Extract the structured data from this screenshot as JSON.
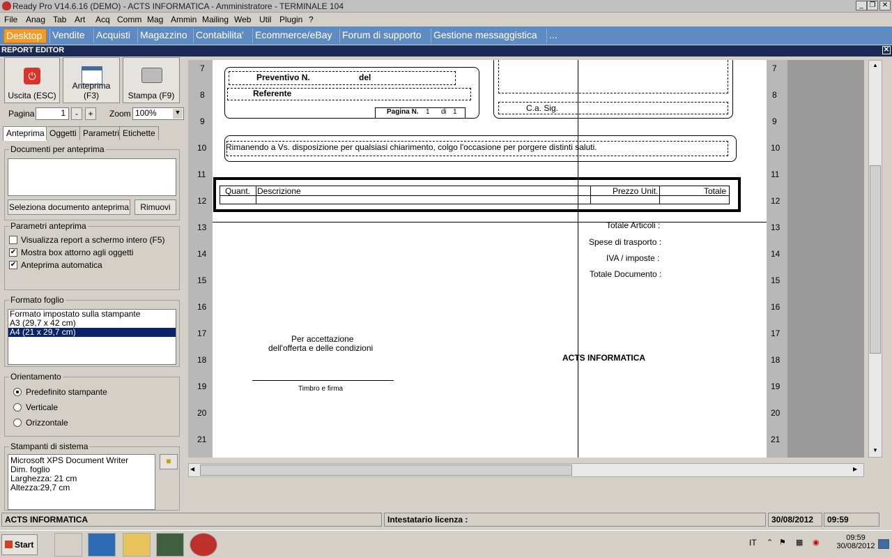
{
  "window": {
    "title": "Ready Pro V14.6.16 (DEMO)  - ACTS INFORMATICA - Amministratore - TERMINALE 104",
    "min": "_",
    "max": "❐",
    "close": "✕"
  },
  "menu": [
    "File",
    "Anag",
    "Tab",
    "Art",
    "Acq",
    "Comm",
    "Mag",
    "Ammin",
    "Mailing",
    "Web",
    "Util",
    "Plugin",
    "?"
  ],
  "main_tabs": [
    "Desktop",
    "Vendite",
    "Acquisti",
    "Magazzino",
    "Contabilita'",
    "Ecommerce/eBay",
    "Forum di supporto",
    "Gestione messaggistica",
    "..."
  ],
  "report_editor": {
    "title": "REPORT EDITOR",
    "close": "✕"
  },
  "toolbar": {
    "exit": "Uscita (ESC)",
    "preview": "Anteprima (F3)",
    "print": "Stampa (F9)"
  },
  "pager": {
    "label": "Pagina",
    "value": "1",
    "minus": "-",
    "plus": "+",
    "zoom_label": "Zoom",
    "zoom_value": "100%"
  },
  "subtabs": [
    "Anteprima",
    "Oggetti",
    "Parametri",
    "Etichette"
  ],
  "docs": {
    "title": "Documenti per anteprima",
    "select_btn": "Seleziona documento anteprima",
    "remove_btn": "Rimuovi"
  },
  "params": {
    "title": "Parametri anteprima",
    "opt1": "Visualizza report a schermo intero (F5)",
    "opt2": "Mostra box attorno agli oggetti",
    "opt3": "Anteprima automatica",
    "opt1_checked": false,
    "opt2_checked": true,
    "opt3_checked": true
  },
  "format": {
    "title": "Formato foglio",
    "items": [
      "Formato impostato sulla stampante",
      "A3 (29,7 x 42 cm)",
      "A4 (21 x 29,7 cm)"
    ],
    "selected": 2
  },
  "orient": {
    "title": "Orientamento",
    "opt1": "Predefinito stampante",
    "opt2": "Verticale",
    "opt3": "Orizzontale",
    "selected": 0
  },
  "printer": {
    "title": "Stampanti di sistema",
    "lines": [
      "Microsoft XPS Document Writer",
      "Dim. foglio",
      "Larghezza: 21 cm",
      "Altezza:29,7 cm"
    ]
  },
  "ruler": [
    "7",
    "8",
    "9",
    "10",
    "11",
    "12",
    "13",
    "14",
    "15",
    "16",
    "17",
    "18",
    "19",
    "20",
    "21"
  ],
  "report": {
    "preventivo": "Preventivo N.",
    "del": "del",
    "referente": "Referente",
    "pagina": "Pagina N.",
    "pagina_val": "1",
    "di": "di",
    "di_val": "1",
    "ca_sig": "C.a. Sig.",
    "saluti": "Rimanendo a Vs. disposizione per qualsiasi chiarimento, colgo l'occasione per porgere distinti saluti.",
    "col_quant": "Quant.",
    "col_descr": "Descrizione",
    "col_prezzo": "Prezzo Unit.",
    "col_totale": "Totale",
    "tot_articoli": "Totale Articoli :",
    "spese": "Spese di trasporto :",
    "iva": "IVA / imposte :",
    "tot_doc": "Totale Documento :",
    "accettazione1": "Per accettazione",
    "accettazione2": "dell'offerta e delle condizioni",
    "timbro": "Timbro e firma",
    "azienda": "ACTS INFORMATICA"
  },
  "status": {
    "company": "ACTS INFORMATICA",
    "license": "Intestatario licenza :",
    "date": "30/08/2012",
    "time": "09:59"
  },
  "taskbar": {
    "start": "Start",
    "lang": "IT",
    "time": "09:59",
    "date": "30/08/2012"
  }
}
